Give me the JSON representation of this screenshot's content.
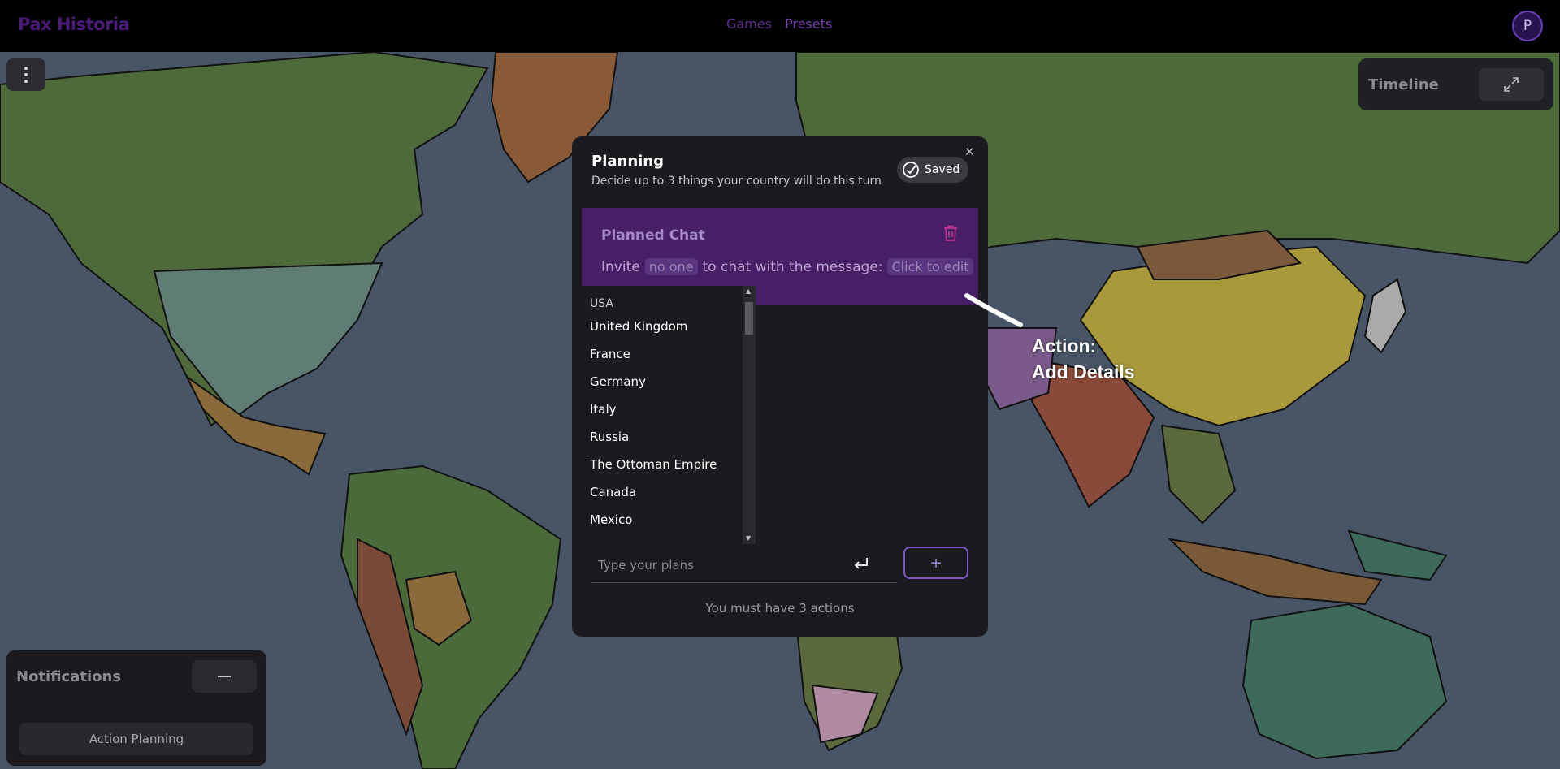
{
  "app": {
    "logo": "Pax Historia"
  },
  "nav": {
    "games": "Games",
    "presets": "Presets"
  },
  "user": {
    "avatar_letter": "P"
  },
  "timeline": {
    "label": "Timeline"
  },
  "notifications": {
    "title": "Notifications",
    "items": [
      "Action Planning"
    ]
  },
  "planning": {
    "title": "Planning",
    "subtitle": "Decide up to 3 things your country will do this turn",
    "saved_label": "Saved",
    "planned_chat": {
      "title": "Planned Chat",
      "invite_prefix": "Invite",
      "invitee": "no one",
      "message_prefix": "to chat with the message:",
      "message": "Click to edit"
    },
    "country_options": [
      "USA",
      "United Kingdom",
      "France",
      "Germany",
      "Italy",
      "Russia",
      "The Ottoman Empire",
      "Canada",
      "Mexico"
    ],
    "input_placeholder": "Type your plans",
    "add_label": "+",
    "requirement": "You must have 3 actions"
  },
  "annotation": {
    "line1": "Action:",
    "line2": "Add Details"
  },
  "colors": {
    "accent": "#7c53c9",
    "planned_bg": "#471f66",
    "trash": "#c0338f",
    "map_ocean": "#475567"
  }
}
